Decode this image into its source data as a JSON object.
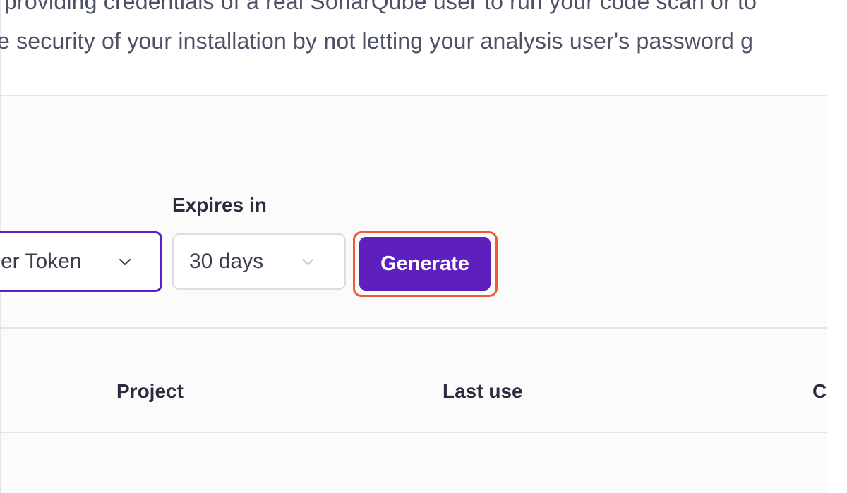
{
  "intro": {
    "line1": "providing credentials of a real SonarQube user to run your code scan or to",
    "line2": "e security of your installation by not letting your analysis user's password g"
  },
  "form": {
    "token_type_value": "er Token",
    "expires_label": "Expires in",
    "expires_value": "30 days",
    "generate_label": "Generate"
  },
  "table": {
    "headers": [
      "Project",
      "Last use",
      "Cre"
    ]
  },
  "colors": {
    "accent": "#5e1fbf",
    "highlight": "#ec5a3a",
    "border": "#e4e5ea"
  },
  "icons": {
    "token_dropdown": "chevron-down-icon",
    "expires_dropdown": "chevron-down-icon"
  }
}
